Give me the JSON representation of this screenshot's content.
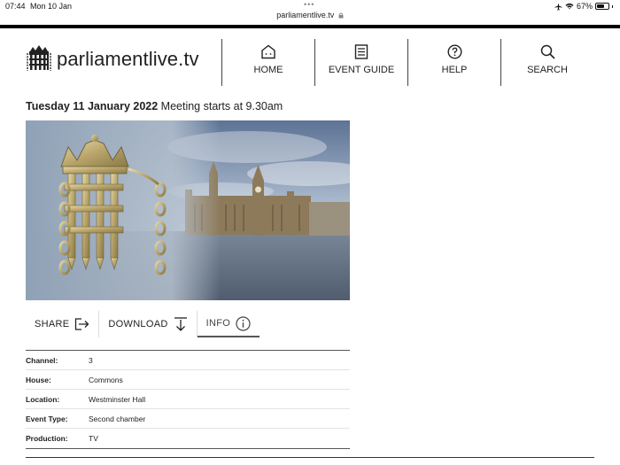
{
  "status_bar": {
    "time": "07:44",
    "date": "Mon 10 Jan",
    "battery": "67%",
    "battery_level": 0.67
  },
  "browser": {
    "url": "parliamentlive.tv"
  },
  "site": {
    "logo_text": "parliamentlive.tv",
    "logo_icon": "portcullis-icon"
  },
  "nav": {
    "home": "HOME",
    "event_guide": "EVENT GUIDE",
    "help": "HELP",
    "search": "SEARCH"
  },
  "meeting": {
    "date": "Tuesday 11 January 2022",
    "starts": "Meeting starts at 9.30am"
  },
  "actions": {
    "share": "SHARE",
    "download": "DOWNLOAD",
    "info": "INFO"
  },
  "info_rows": [
    {
      "key": "Channel:",
      "value": "3"
    },
    {
      "key": "House:",
      "value": "Commons"
    },
    {
      "key": "Location:",
      "value": "Westminster Hall"
    },
    {
      "key": "Event Type:",
      "value": "Second chamber"
    },
    {
      "key": "Production:",
      "value": "TV"
    }
  ],
  "colors": {
    "accent": "#000000",
    "text": "#222222",
    "portcullis_gold": "#c9b57a"
  }
}
